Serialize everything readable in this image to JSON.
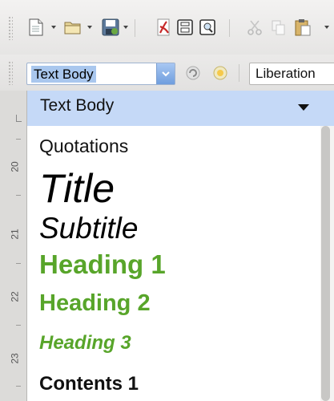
{
  "toolbar": {
    "icons": [
      "new-document-icon",
      "open-folder-icon",
      "save-icon",
      "export-pdf-icon",
      "print-icon",
      "print-preview-icon",
      "cut-icon",
      "copy-icon",
      "paste-icon"
    ]
  },
  "formatting": {
    "paragraph_style": "Text Body",
    "font_name": "Liberation"
  },
  "ruler": {
    "numbers": [
      "20",
      "21",
      "22",
      "23"
    ]
  },
  "style_list": {
    "selected": "Text Body",
    "items": [
      "Quotations",
      "Title",
      "Subtitle",
      "Heading 1",
      "Heading 2",
      "Heading 3",
      "Contents 1"
    ]
  },
  "colors": {
    "heading_green": "#58a52a",
    "selection_blue": "#c5d9f7"
  }
}
